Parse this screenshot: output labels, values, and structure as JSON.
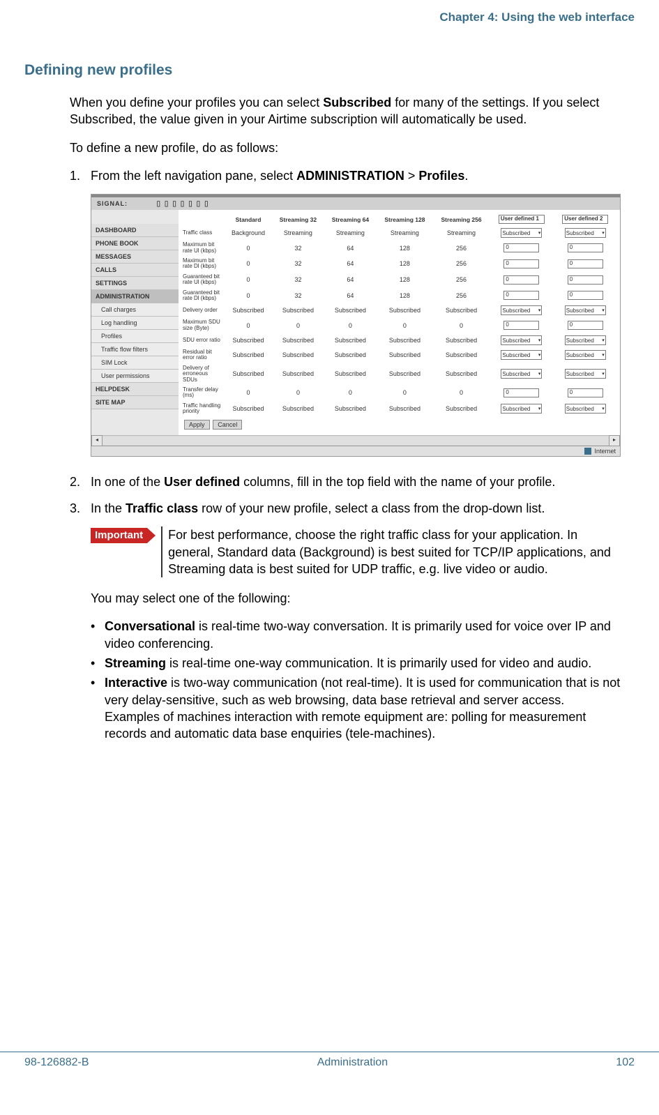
{
  "chapter_header": "Chapter 4: Using the web interface",
  "section_title": "Defining new profiles",
  "intro": {
    "p1a": "When you define your profiles you can select ",
    "p1b": "Subscribed",
    "p1c": " for many of the settings. If you select Subscribed, the value given in your Airtime subscription will automatically be used.",
    "p2": "To define a new profile, do as follows:"
  },
  "steps": {
    "s1_num": "1.",
    "s1a": "From the left navigation pane, select ",
    "s1b": "ADMINISTRATION",
    "s1c": " > ",
    "s1d": "Profiles",
    "s1e": ".",
    "s2_num": "2.",
    "s2a": "In one of the ",
    "s2b": "User defined",
    "s2c": " columns, fill in the top field with the name of your profile.",
    "s3_num": "3.",
    "s3a": "In the ",
    "s3b": "Traffic class",
    "s3c": " row of your new profile, select a class from the drop-down list."
  },
  "important": {
    "label": "Important",
    "text": "For best performance, choose the right traffic class for your application. In general, Standard data (Background) is best suited for TCP/IP applications, and Streaming data is best suited for UDP traffic, e.g. live video or audio."
  },
  "post_imp": "You may select one of the following:",
  "bullets": {
    "b1a": "Conversational",
    "b1b": " is real-time two-way conversation. It is primarily used for voice over IP and video conferencing.",
    "b2a": "Streaming",
    "b2b": " is real-time one-way communication. It is primarily used for video and audio.",
    "b3a": "Interactive",
    "b3b": " is two-way communication (not real-time). It is used for communication that is not very delay-sensitive, such as web browsing, data base retrieval and server access. Examples of machines interaction with remote equipment are: polling for measurement records and automatic data base enquiries (tele-machines)."
  },
  "screenshot": {
    "signal_label": "SIGNAL:",
    "signal_bars": "▯▯▯▯▯▯▯",
    "sidebar": {
      "dashboard": "DASHBOARD",
      "phonebook": "PHONE BOOK",
      "messages": "MESSAGES",
      "calls": "CALLS",
      "settings": "SETTINGS",
      "administration": "ADMINISTRATION",
      "call_charges": "Call charges",
      "log_handling": "Log handling",
      "profiles": "Profiles",
      "traffic_flow": "Traffic flow filters",
      "sim_lock": "SIM Lock",
      "user_perms": "User permissions",
      "helpdesk": "HELPDESK",
      "sitemap": "SITE MAP"
    },
    "columns": {
      "c1": "Standard",
      "c2": "Streaming 32",
      "c3": "Streaming 64",
      "c4": "Streaming 128",
      "c5": "Streaming 256",
      "c6": "User defined 1",
      "c7": "User defined 2"
    },
    "rows": {
      "r1": "Traffic class",
      "r2": "Maximum bit rate Ul (kbps)",
      "r3": "Maximum bit rate Dl (kbps)",
      "r4": "Guaranteed bit rate Ul (kbps)",
      "r5": "Guaranteed bit rate Dl (kbps)",
      "r6": "Delivery order",
      "r7": "Maximum SDU size (Byte)",
      "r8": "SDU error ratio",
      "r9": "Residual bit error ratio",
      "r10": "Delivery of erroneous SDUs",
      "r11": "Transfer delay (ms)",
      "r12": "Traffic handling priority"
    },
    "vals": {
      "background": "Background",
      "streaming": "Streaming",
      "subscribed": "Subscribed",
      "zero": "0",
      "v32": "32",
      "v64": "64",
      "v128": "128",
      "v256": "256"
    },
    "buttons": {
      "apply": "Apply",
      "cancel": "Cancel"
    },
    "status": "Internet"
  },
  "footer": {
    "left": "98-126882-B",
    "center": "Administration",
    "right": "102"
  }
}
